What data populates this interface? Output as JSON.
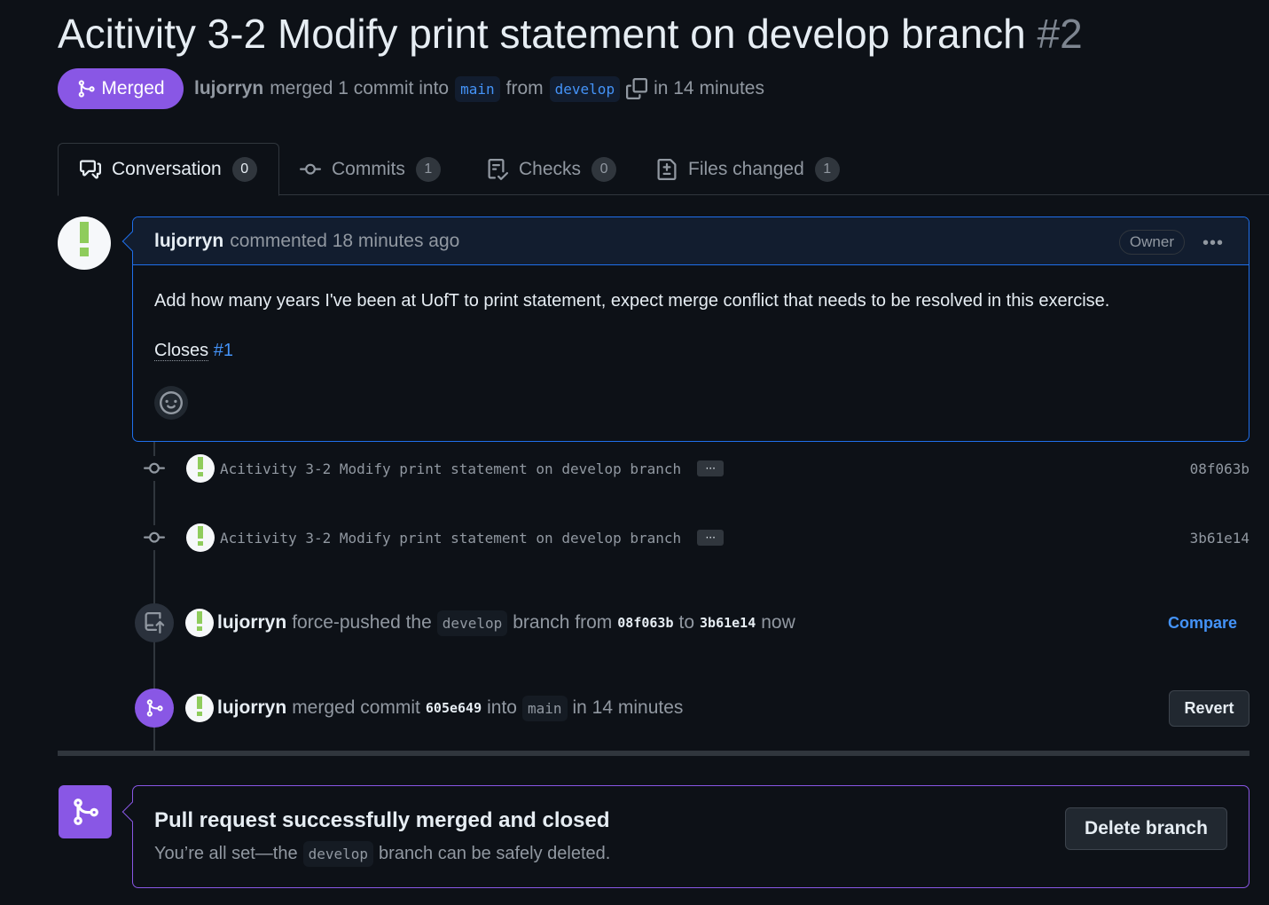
{
  "pr": {
    "title": "Acitivity 3-2 Modify print statement on develop branch",
    "number": "#2",
    "state": "Merged",
    "author": "lujorryn",
    "merged_text": "merged 1 commit into",
    "base_branch": "main",
    "from_text": "from",
    "head_branch": "develop",
    "time_text": "in 14 minutes"
  },
  "tabs": [
    {
      "label": "Conversation",
      "count": "0"
    },
    {
      "label": "Commits",
      "count": "1"
    },
    {
      "label": "Checks",
      "count": "0"
    },
    {
      "label": "Files changed",
      "count": "1"
    }
  ],
  "comment": {
    "author": "lujorryn",
    "action": "commented 18 minutes ago",
    "role": "Owner",
    "body": "Add how many years I've been at UofT to print statement, expect merge conflict that needs to be resolved in this exercise.",
    "closes_label": "Closes",
    "closes_ref": "#1"
  },
  "commits": [
    {
      "message": "Acitivity 3-2 Modify print statement on develop branch",
      "sha": "08f063b"
    },
    {
      "message": "Acitivity 3-2 Modify print statement on develop branch",
      "sha": "3b61e14"
    }
  ],
  "force_push": {
    "author": "lujorryn",
    "text1": "force-pushed the",
    "branch": "develop",
    "text2": "branch from",
    "from_sha": "08f063b",
    "to": "to",
    "to_sha": "3b61e14",
    "time": "now",
    "compare": "Compare"
  },
  "merge_event": {
    "author": "lujorryn",
    "text1": "merged commit",
    "sha": "605e649",
    "into": "into",
    "branch": "main",
    "time": "in 14 minutes",
    "revert": "Revert"
  },
  "merge_box": {
    "title": "Pull request successfully merged and closed",
    "sub1": "You’re all set—the",
    "branch": "develop",
    "sub2": "branch can be safely deleted.",
    "delete": "Delete branch"
  },
  "colors": {
    "merged_purple": "#8957e5",
    "link_blue": "#4493f8",
    "background": "#0d1117",
    "avatar_green": "#8fcc5c"
  }
}
